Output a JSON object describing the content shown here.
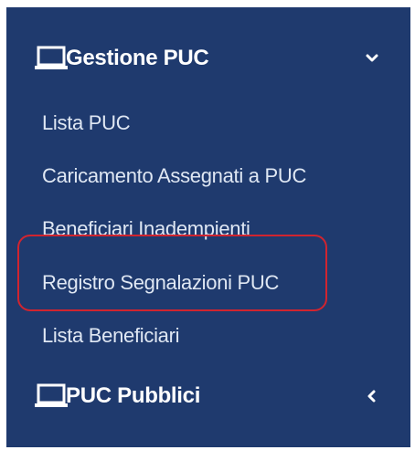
{
  "sidebar": {
    "groups": [
      {
        "label": "Gestione PUC",
        "icon": "laptop-icon",
        "expanded": true,
        "chevron": "chevron-down-icon",
        "items": [
          {
            "label": "Lista PUC"
          },
          {
            "label": "Caricamento Assegnati a PUC"
          },
          {
            "label": "Beneficiari Inadempienti"
          },
          {
            "label": "Registro Segnalazioni PUC",
            "highlighted": true
          },
          {
            "label": "Lista Beneficiari"
          }
        ]
      },
      {
        "label": "PUC Pubblici",
        "icon": "laptop-icon",
        "expanded": false,
        "chevron": "chevron-left-icon"
      }
    ]
  },
  "colors": {
    "sidebar_background": "#1f3a6e",
    "text": "#dfe7f3",
    "highlight_border": "#d1242f"
  }
}
